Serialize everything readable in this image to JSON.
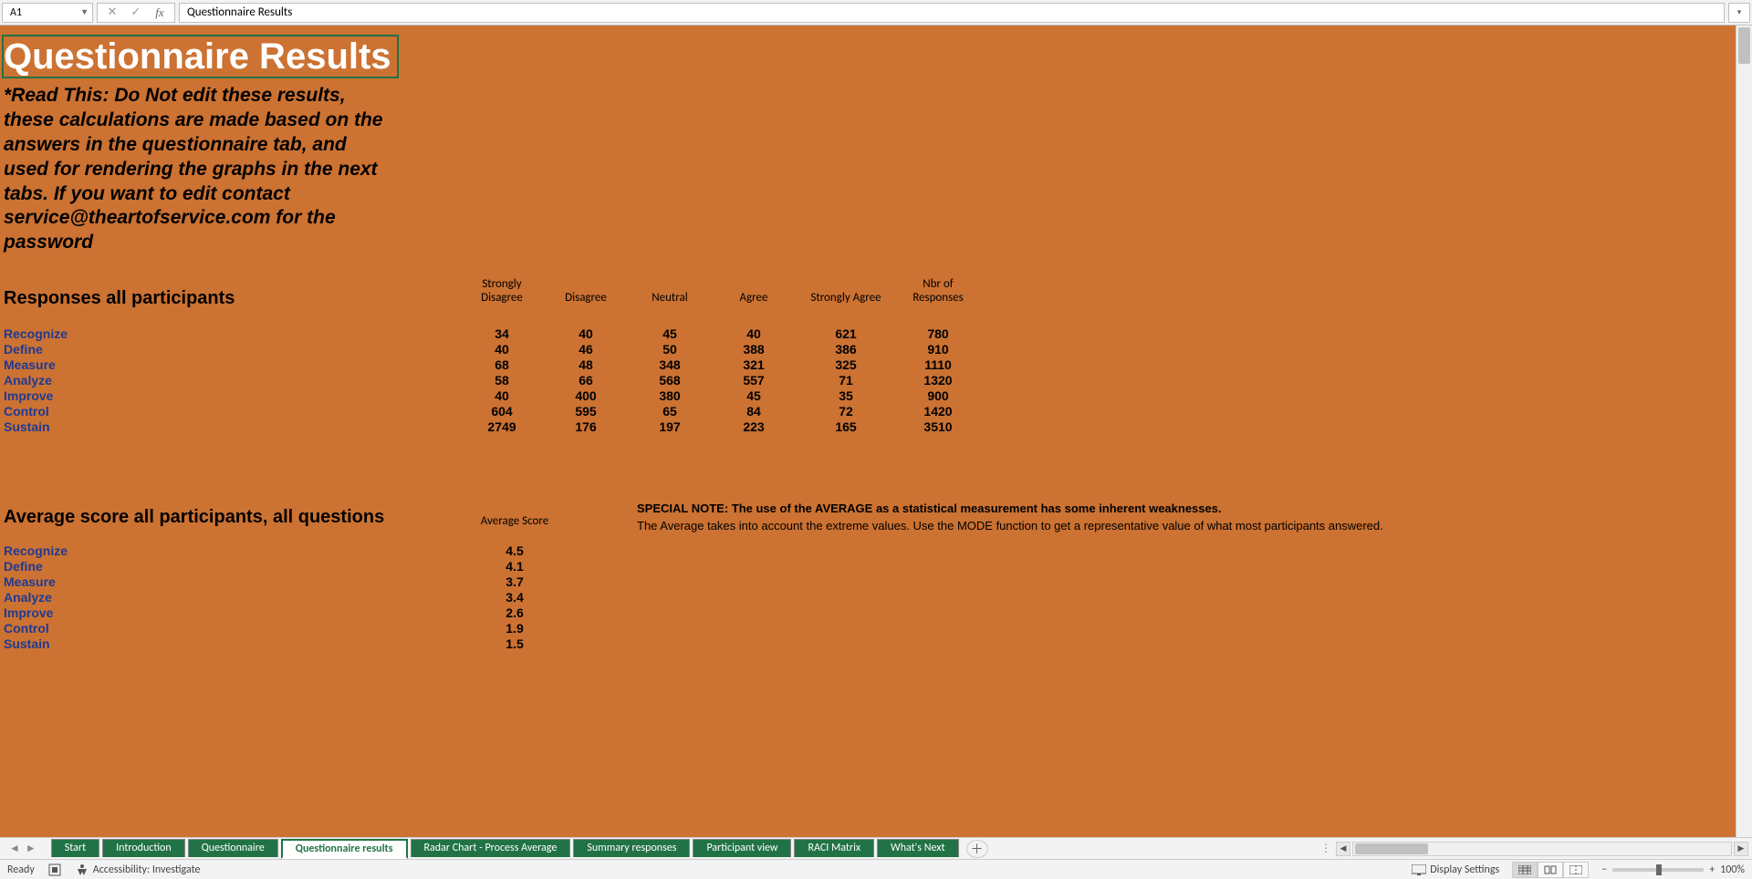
{
  "formula_bar": {
    "cell_ref": "A1",
    "formula_value": "Questionnaire Results"
  },
  "sheet": {
    "title": "Questionnaire Results",
    "warning": "*Read This: Do Not edit these results, these calculations are made based on the answers in the questionnaire tab, and used for rendering the graphs in the next tabs. If you want to edit contact service@theartofservice.com for the password",
    "section1_header": "Responses all participants",
    "columns": {
      "c1": "Strongly\nDisagree",
      "c2": "Disagree",
      "c3": "Neutral",
      "c4": "Agree",
      "c5": "Strongly Agree",
      "c6": "Nbr of\nResponses"
    },
    "rows": [
      {
        "label": "Recognize",
        "v": [
          34,
          40,
          45,
          40,
          621,
          780
        ]
      },
      {
        "label": "Define",
        "v": [
          40,
          46,
          50,
          388,
          386,
          910
        ]
      },
      {
        "label": "Measure",
        "v": [
          68,
          48,
          348,
          321,
          325,
          1110
        ]
      },
      {
        "label": "Analyze",
        "v": [
          58,
          66,
          568,
          557,
          71,
          1320
        ]
      },
      {
        "label": "Improve",
        "v": [
          40,
          400,
          380,
          45,
          35,
          900
        ]
      },
      {
        "label": "Control",
        "v": [
          604,
          595,
          65,
          84,
          72,
          1420
        ]
      },
      {
        "label": "Sustain",
        "v": [
          2749,
          176,
          197,
          223,
          165,
          3510
        ]
      }
    ],
    "section2_header": "Average score all participants, all questions",
    "avg_col_header": "Average Score",
    "avg_rows": [
      {
        "label": "Recognize",
        "v": "4.5"
      },
      {
        "label": "Define",
        "v": "4.1"
      },
      {
        "label": "Measure",
        "v": "3.7"
      },
      {
        "label": "Analyze",
        "v": "3.4"
      },
      {
        "label": "Improve",
        "v": "2.6"
      },
      {
        "label": "Control",
        "v": "1.9"
      },
      {
        "label": "Sustain",
        "v": "1.5"
      }
    ],
    "note_bold": "SPECIAL NOTE: The use of the AVERAGE as a statistical measurement has some inherent weaknesses.",
    "note_plain": "The Average takes into account the extreme values. Use the MODE function to get a representative value of what most participants answered."
  },
  "tabs": [
    {
      "label": "Start",
      "active": false
    },
    {
      "label": "Introduction",
      "active": false
    },
    {
      "label": "Questionnaire",
      "active": false
    },
    {
      "label": "Questionnaire results",
      "active": true
    },
    {
      "label": "Radar Chart - Process Average",
      "active": false
    },
    {
      "label": "Summary responses",
      "active": false
    },
    {
      "label": "Participant view",
      "active": false
    },
    {
      "label": "RACI Matrix",
      "active": false
    },
    {
      "label": "What's Next",
      "active": false
    }
  ],
  "status": {
    "ready": "Ready",
    "accessibility": "Accessibility: Investigate",
    "display_settings": "Display Settings",
    "zoom": "100%"
  },
  "chart_data": {
    "type": "table",
    "title": "Responses all participants",
    "categories": [
      "Recognize",
      "Define",
      "Measure",
      "Analyze",
      "Improve",
      "Control",
      "Sustain"
    ],
    "series": [
      {
        "name": "Strongly Disagree",
        "values": [
          34,
          40,
          68,
          58,
          40,
          604,
          2749
        ]
      },
      {
        "name": "Disagree",
        "values": [
          40,
          46,
          48,
          66,
          400,
          595,
          176
        ]
      },
      {
        "name": "Neutral",
        "values": [
          45,
          50,
          348,
          568,
          380,
          65,
          197
        ]
      },
      {
        "name": "Agree",
        "values": [
          40,
          388,
          321,
          557,
          45,
          84,
          223
        ]
      },
      {
        "name": "Strongly Agree",
        "values": [
          621,
          386,
          325,
          71,
          35,
          72,
          165
        ]
      },
      {
        "name": "Nbr of Responses",
        "values": [
          780,
          910,
          1110,
          1320,
          900,
          1420,
          3510
        ]
      }
    ],
    "averages": {
      "title": "Average score all participants, all questions",
      "categories": [
        "Recognize",
        "Define",
        "Measure",
        "Analyze",
        "Improve",
        "Control",
        "Sustain"
      ],
      "values": [
        4.5,
        4.1,
        3.7,
        3.4,
        2.6,
        1.9,
        1.5
      ]
    }
  }
}
